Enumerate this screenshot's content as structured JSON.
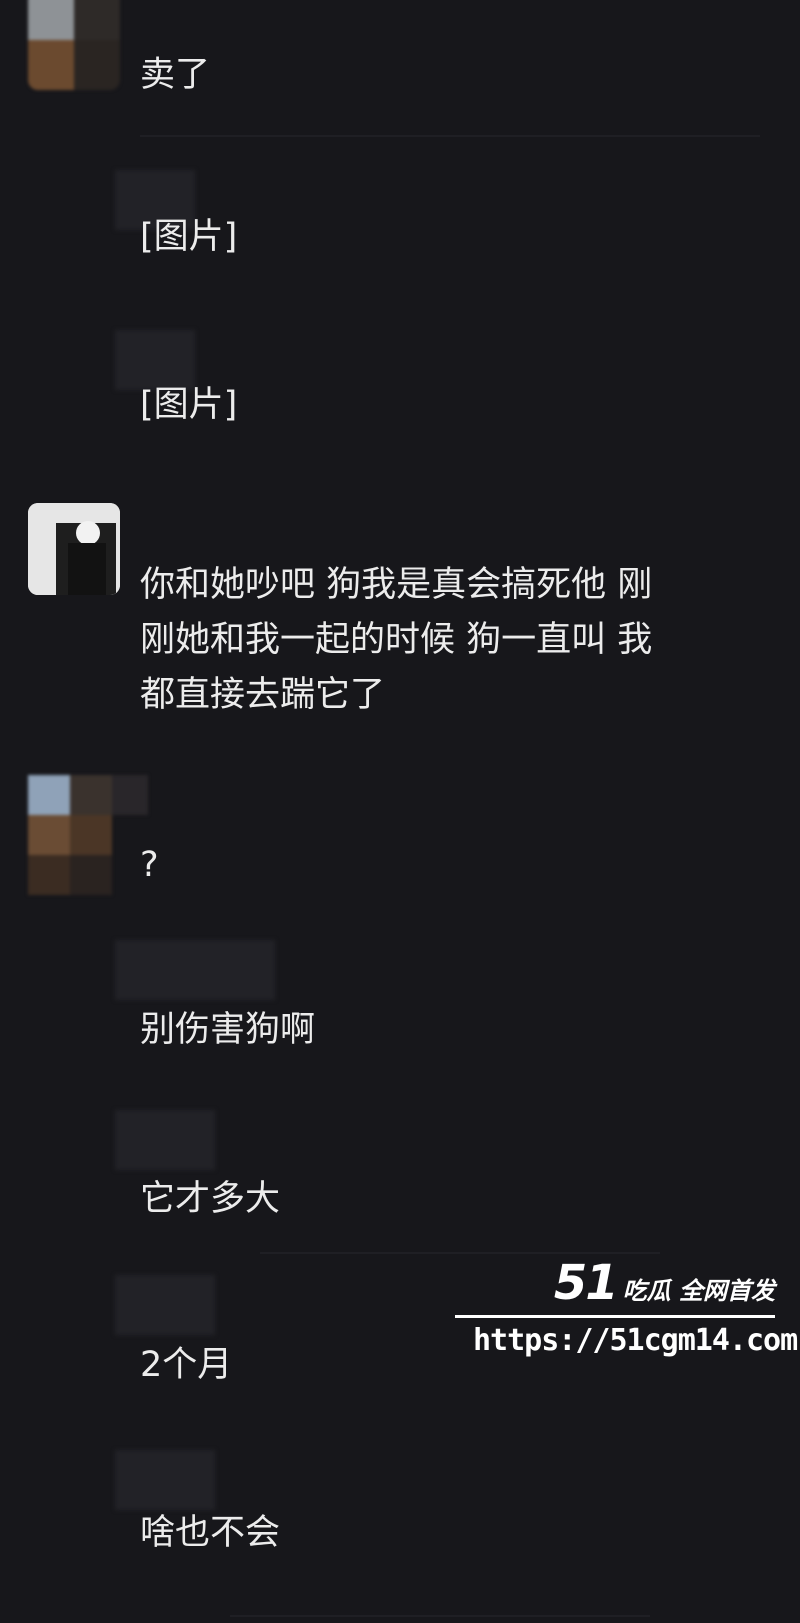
{
  "messages": [
    {
      "text": "卖了"
    },
    {
      "text": "[图片]"
    },
    {
      "text": "[图片]"
    },
    {
      "text": "你和她吵吧 狗我是真会搞死他 刚\n刚她和我一起的时候 狗一直叫 我\n都直接去踹它了"
    },
    {
      "text": "?"
    },
    {
      "text": "别伤害狗啊"
    },
    {
      "text": "它才多大"
    },
    {
      "text": "2个月"
    },
    {
      "text": "啥也不会"
    }
  ],
  "watermark": {
    "logo_number": "51",
    "logo_text": "吃瓜 全网首发",
    "url": "https://51cgm14.com"
  },
  "colors": {
    "background": "#17171b",
    "text": "#ececec"
  }
}
